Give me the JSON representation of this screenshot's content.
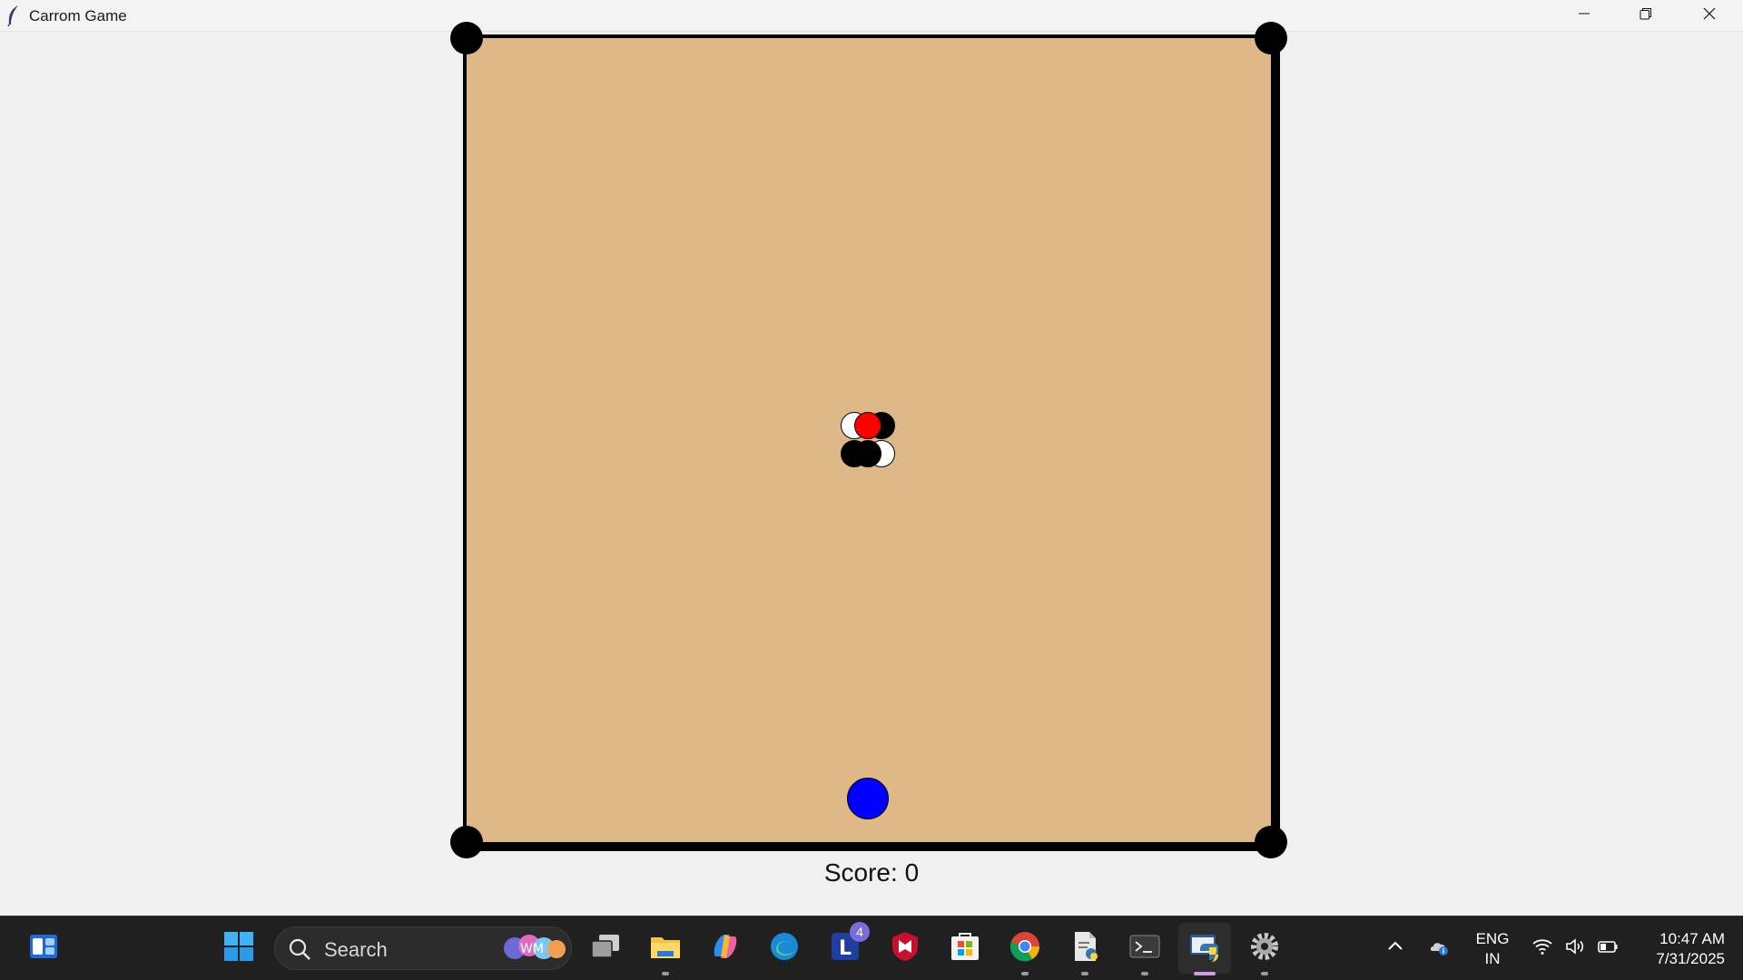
{
  "window": {
    "title": "Carrom Game",
    "icon": "feather-icon",
    "controls": [
      "minimize-icon",
      "restore-icon",
      "close-icon"
    ]
  },
  "game": {
    "board_color": "#deb887",
    "border_color": "#000000",
    "pockets": [
      "top-left",
      "top-right",
      "bottom-left",
      "bottom-right"
    ],
    "coins": [
      {
        "color": "white"
      },
      {
        "color": "black"
      },
      {
        "color": "black"
      },
      {
        "color": "white"
      },
      {
        "color": "red"
      }
    ],
    "striker_color": "#0000ff",
    "score_text": "Score: 0"
  },
  "taskbar": {
    "search_placeholder": "Search",
    "pinned": [
      {
        "name": "widgets-icon"
      },
      {
        "name": "start-icon"
      },
      {
        "name": "task-view-icon"
      },
      {
        "name": "file-explorer-icon",
        "running": true
      },
      {
        "name": "copilot-icon"
      },
      {
        "name": "edge-icon"
      },
      {
        "name": "l-app-icon",
        "badge": "4"
      },
      {
        "name": "mcafee-icon"
      },
      {
        "name": "microsoft-store-icon"
      },
      {
        "name": "chrome-icon",
        "running": true
      },
      {
        "name": "python-file-icon",
        "running": true
      },
      {
        "name": "terminal-icon",
        "running": true
      },
      {
        "name": "python-icon",
        "running": true,
        "active": true
      },
      {
        "name": "settings-icon",
        "running": true
      }
    ],
    "tray": {
      "language_line1": "ENG",
      "language_line2": "IN",
      "time": "10:47 AM",
      "date": "7/31/2025"
    }
  }
}
